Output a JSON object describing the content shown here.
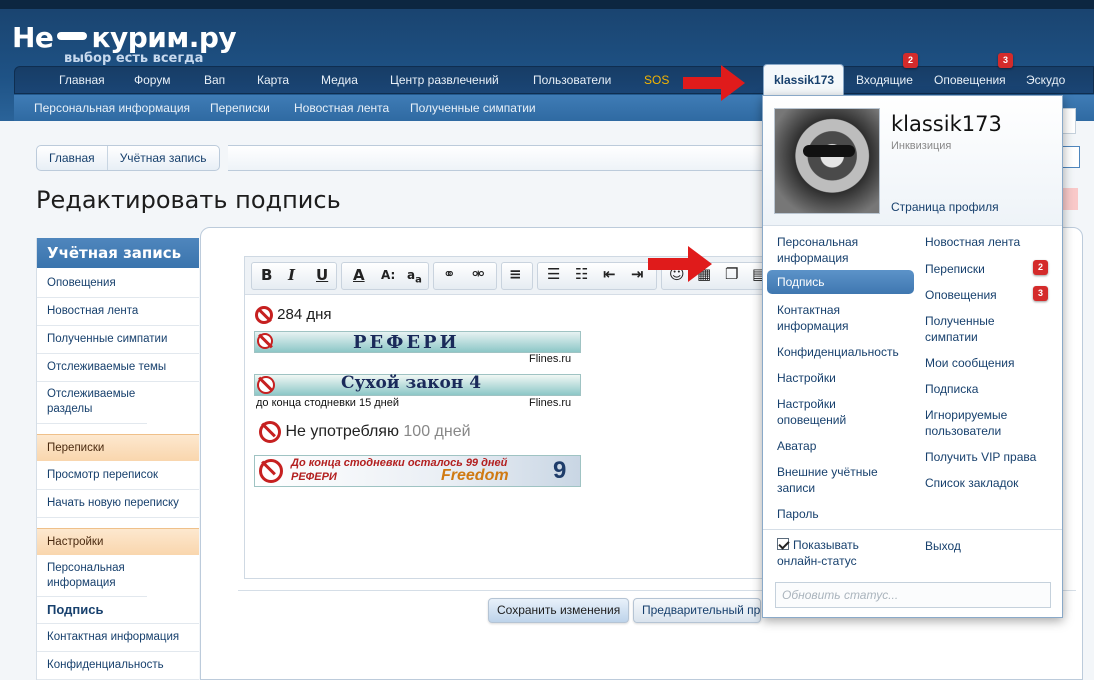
{
  "site": {
    "logo": "Не курим.ру",
    "tagline": "выбор есть всегда"
  },
  "nav": {
    "items": [
      "Главная",
      "Форум",
      "Вап",
      "Карта",
      "Медиа",
      "Центр развлечений",
      "Пользователи",
      "SOS"
    ],
    "user_tab": "klassik173",
    "inbox": "Входящие",
    "inbox_count": "2",
    "alerts": "Оповещения",
    "alerts_count": "3",
    "escudo": "Эскудо"
  },
  "subnav": [
    "Персональная информация",
    "Переписки",
    "Новостная лента",
    "Полученные симпатии"
  ],
  "breadcrumb": [
    "Главная",
    "Учётная запись"
  ],
  "page_title": "Редактировать подпись",
  "sidebar": {
    "title": "Учётная запись",
    "items": [
      "Оповещения",
      "Новостная лента",
      "Полученные симпатии",
      "Отслеживаемые темы",
      "Отслеживаемые разделы"
    ],
    "group_conversations": "Переписки",
    "conv_items": [
      "Просмотр переписок",
      "Начать новую переписку"
    ],
    "group_settings": "Настройки",
    "settings_items": [
      "Персональная информация",
      "Подпись",
      "Контактная информация",
      "Конфиденциальность"
    ]
  },
  "signature": {
    "line1": "284 дня",
    "banner1_text": "РЕФЕРИ",
    "banner1_source": "Flines.ru",
    "banner2_text": "Сухой закон 4",
    "banner2_caption": "до конца стодневки 15 дней",
    "banner2_source": "Flines.ru",
    "line3_text": "Не употребляю",
    "line3_days": "100 дней",
    "banner4_line1": "До конца стодневки осталось 99 дней",
    "banner4_line2": "РЕФЕРИ",
    "banner4_word": "Freedom",
    "banner4_num": "9"
  },
  "buttons": {
    "save": "Сохранить изменения",
    "preview": "Предварительный просмотр"
  },
  "popup": {
    "username": "klassik173",
    "role": "Инквизиция",
    "profile_link": "Страница профиля",
    "left": [
      "Персональная информация",
      "Подпись",
      "Контактная информация",
      "Конфиденциальность",
      "Настройки",
      "Настройки оповещений",
      "Аватар",
      "Внешние учётные записи",
      "Пароль"
    ],
    "right": [
      "Новостная лента",
      "Переписки",
      "Оповещения",
      "Полученные симпатии",
      "Мои сообщения",
      "Подписка",
      "Игнорируемые пользователи",
      "Получить VIP права",
      "Список закладок"
    ],
    "conv_count": "2",
    "alerts_count": "3",
    "show_online": "Показывать онлайн-статус",
    "logout": "Выход",
    "status_placeholder": "Обновить статус..."
  },
  "colors": {
    "header": "#1e5285",
    "accent": "#3f77b0",
    "badge": "#d42b2b",
    "arrow": "#e01b1b",
    "sos": "#f4b400"
  }
}
